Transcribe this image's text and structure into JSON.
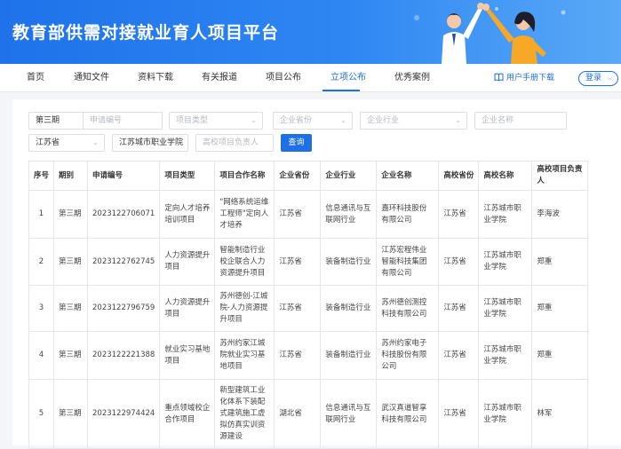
{
  "banner": {
    "title": "教育部供需对接就业育人项目平台"
  },
  "nav": {
    "items": [
      "首页",
      "通知文件",
      "资料下载",
      "有关报道",
      "项目公布",
      "立项公布",
      "优秀案例"
    ],
    "active": "立项公布",
    "manual": "用户手册下载",
    "login": "登录"
  },
  "filters": {
    "batch": "第三期",
    "apply_no_ph": "申请编号",
    "project_type_ph": "项目类型",
    "ent_province_ph": "企业省份",
    "ent_industry_ph": "企业行业",
    "ent_name_ph": "企业名称",
    "uni_province": "江苏省",
    "uni_name": "江苏城市职业学院",
    "uni_leader_ph": "高校项目负责人",
    "query": "查询"
  },
  "table": {
    "headers": [
      "序号",
      "期别",
      "申请编号",
      "项目类型",
      "项目合作名称",
      "企业省份",
      "企业行业",
      "企业名称",
      "高校省份",
      "高校名称",
      "高校项目负责人"
    ],
    "rows": [
      [
        "1",
        "第三期",
        "2023122706071",
        "定向人才培养培训项目",
        "\"网络系统运维工程师\"定向人才培养",
        "江苏省",
        "信息通讯与互联网行业",
        "嘉环科技股份有限公司",
        "江苏省",
        "江苏城市职业学院",
        "李海波"
      ],
      [
        "2",
        "第三期",
        "2023122762745",
        "人力资源提升项目",
        "智能制造行业校企联合人力资源提升项目",
        "江苏省",
        "装备制造行业",
        "江苏宏程伟业智能科技集团有限公司",
        "江苏省",
        "江苏城市职业学院",
        "郑重"
      ],
      [
        "3",
        "第三期",
        "2023122796759",
        "人力资源提升项目",
        "苏州德创-江城院-人力资源提升项目",
        "江苏省",
        "装备制造行业",
        "苏州德创测控科技有限公司",
        "江苏省",
        "江苏城市职业学院",
        "郑重"
      ],
      [
        "4",
        "第三期",
        "2023122221388",
        "就业实习基地项目",
        "苏州约家江城院就业实习基地项目",
        "江苏省",
        "装备制造行业",
        "苏州约家电子科技股份有限公司",
        "江苏省",
        "江苏城市职业学院",
        "郑重"
      ],
      [
        "5",
        "第三期",
        "2023122974424",
        "重点领域校企合作项目",
        "新型建筑工业化体系下装配式建筑施工虚拟仿真实训资源建设",
        "湖北省",
        "信息通讯与互联网行业",
        "武汉真道智享科技有限公司",
        "江苏省",
        "江苏城市职业学院",
        "林军"
      ]
    ]
  },
  "colors": {
    "brand": "#1f6fe5",
    "banner_start": "#1f72ea",
    "banner_end": "#59a9f7"
  }
}
